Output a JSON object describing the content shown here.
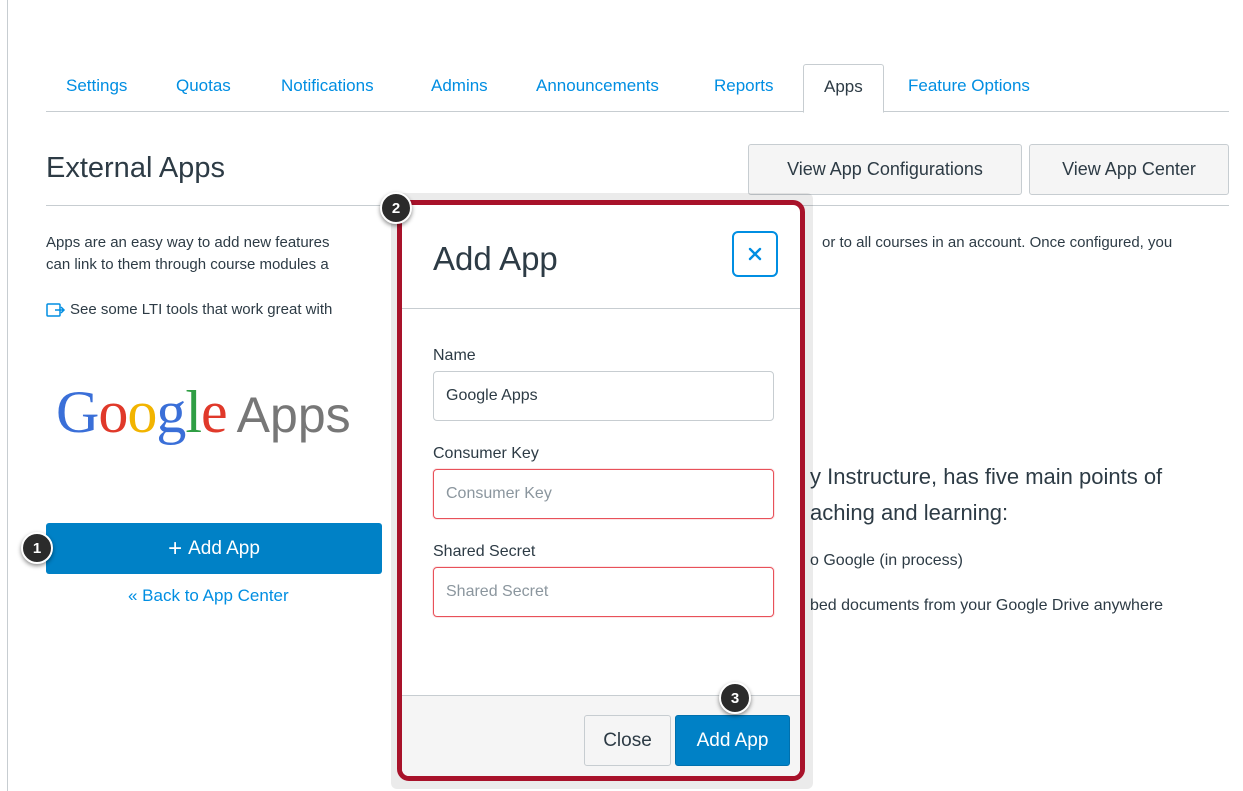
{
  "tabs": [
    {
      "label": "Settings"
    },
    {
      "label": "Quotas"
    },
    {
      "label": "Notifications"
    },
    {
      "label": "Admins"
    },
    {
      "label": "Announcements"
    },
    {
      "label": "Reports"
    },
    {
      "label": "Apps",
      "active": true
    },
    {
      "label": "Feature Options"
    }
  ],
  "header": {
    "title": "External Apps",
    "view_configs_label": "View App Configurations",
    "view_center_label": "View App Center"
  },
  "description": {
    "line1_start": "Apps are an easy way to add new features",
    "line1_end": "or to all courses in an account. Once configured, you",
    "line2_start": "can link to them through course modules a"
  },
  "lti_link": {
    "icon": "external-link-icon",
    "text": "See some LTI tools that work great with"
  },
  "app": {
    "logo_google": "Google",
    "logo_apps": "Apps",
    "add_button_label": "Add App",
    "back_link": "« Back to App Center",
    "text_line1": "y Instructure, has five main points of",
    "text_line2": "aching and learning:",
    "bullet1": "o Google (in process)",
    "bullet2": "bed documents from your Google Drive anywhere"
  },
  "callouts": [
    "1",
    "2",
    "3"
  ],
  "modal": {
    "title": "Add App",
    "close_icon": "close-icon",
    "name_label": "Name",
    "name_value": "Google Apps",
    "consumer_key_label": "Consumer Key",
    "consumer_key_placeholder": "Consumer Key",
    "shared_secret_label": "Shared Secret",
    "shared_secret_placeholder": "Shared Secret",
    "close_button": "Close",
    "add_button": "Add App"
  },
  "colors": {
    "accent": "#008ee2",
    "primary_button": "#0081c6",
    "highlight_border": "#a8122a",
    "error_border": "#e8515a"
  }
}
